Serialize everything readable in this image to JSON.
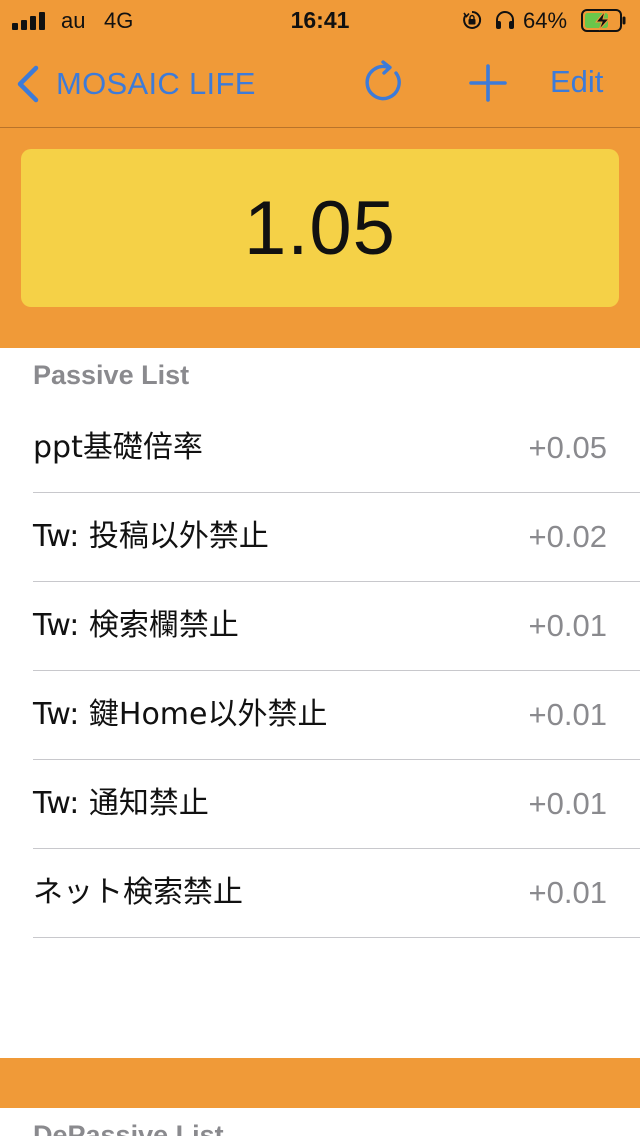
{
  "status_bar": {
    "carrier": "au",
    "network": "4G",
    "time": "16:41",
    "battery_percent": "64%",
    "icons": [
      "signal-bars-icon",
      "rotation-lock-icon",
      "headphones-icon",
      "battery-charging-icon"
    ]
  },
  "nav": {
    "back_label": "MOSAIC LIFE",
    "edit_label": "Edit",
    "icons": [
      "chevron-left-icon",
      "refresh-icon",
      "plus-icon"
    ],
    "accent_color": "#3d7bd9",
    "bar_color": "#f09a38"
  },
  "score": {
    "value": "1.05",
    "card_color": "#f5d147"
  },
  "passive_list": {
    "header": "Passive List",
    "items": [
      {
        "name": "ppt基礎倍率",
        "value": "+0.05"
      },
      {
        "name": "Tw: 投稿以外禁止",
        "value": "+0.02"
      },
      {
        "name": "Tw: 検索欄禁止",
        "value": "+0.01"
      },
      {
        "name": "Tw: 鍵Home以外禁止",
        "value": "+0.01"
      },
      {
        "name": "Tw: 通知禁止",
        "value": "+0.01"
      },
      {
        "name": "ネット検索禁止",
        "value": "+0.01"
      }
    ]
  },
  "depassive_list": {
    "header": "DePassive List"
  }
}
